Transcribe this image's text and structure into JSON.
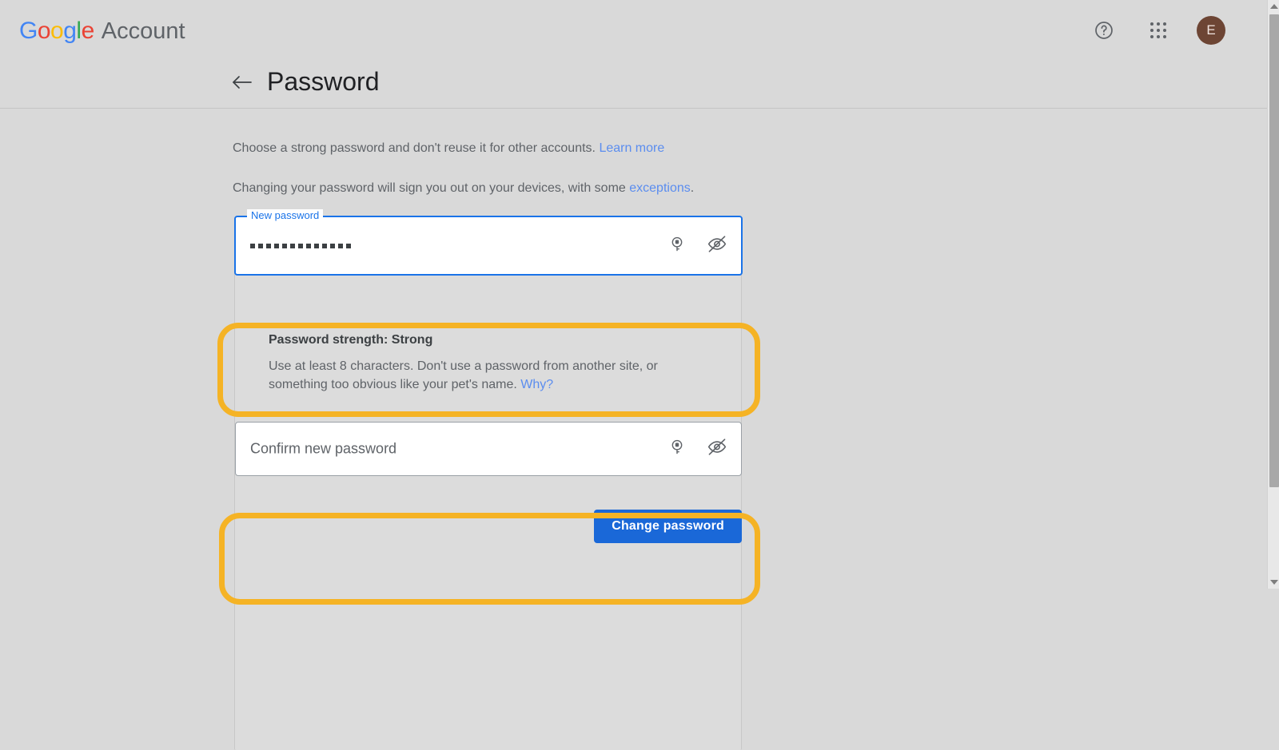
{
  "header": {
    "logo_letters": [
      "G",
      "o",
      "o",
      "g",
      "l",
      "e"
    ],
    "product_name": "Account",
    "help_icon": "help-circle-icon",
    "apps_icon": "apps-grid-icon",
    "avatar_initial": "E",
    "avatar_color": "#6d4534"
  },
  "page": {
    "back_label": "←",
    "title": "Password"
  },
  "intro": {
    "line1_text": "Choose a strong password and don't reuse it for other accounts. ",
    "line1_link": "Learn more",
    "line2_text": "Changing your password will sign you out on your devices, with some ",
    "line2_link": "exceptions",
    "line2_tail": "."
  },
  "form": {
    "new_password": {
      "label": "New password",
      "value_masked": "•••••••••••••",
      "dot_count": 13,
      "key_icon": "password-key-icon",
      "visibility_icon": "eye-off-icon",
      "focused": true
    },
    "strength": {
      "title": "Password strength: Strong",
      "hint_text": "Use at least 8 characters. Don't use a password from another site, or something too obvious like your pet's name. ",
      "hint_link": "Why?"
    },
    "confirm_password": {
      "placeholder": "Confirm new password",
      "value": "",
      "key_icon": "password-key-icon",
      "visibility_icon": "eye-off-icon",
      "focused": false
    },
    "submit_label": "Change password"
  },
  "highlights": {
    "color": "#f5b325",
    "count": 2
  },
  "scrollbar": {
    "up_arrow": "scroll-up-arrow-icon",
    "down_arrow": "scroll-down-arrow-icon"
  },
  "colors": {
    "background": "#d9d9d9",
    "primary_blue": "#1a73e8",
    "link_blue": "#5b8def",
    "text_primary": "#202124",
    "text_secondary": "#5f6368",
    "highlight_yellow": "#f5b325"
  }
}
